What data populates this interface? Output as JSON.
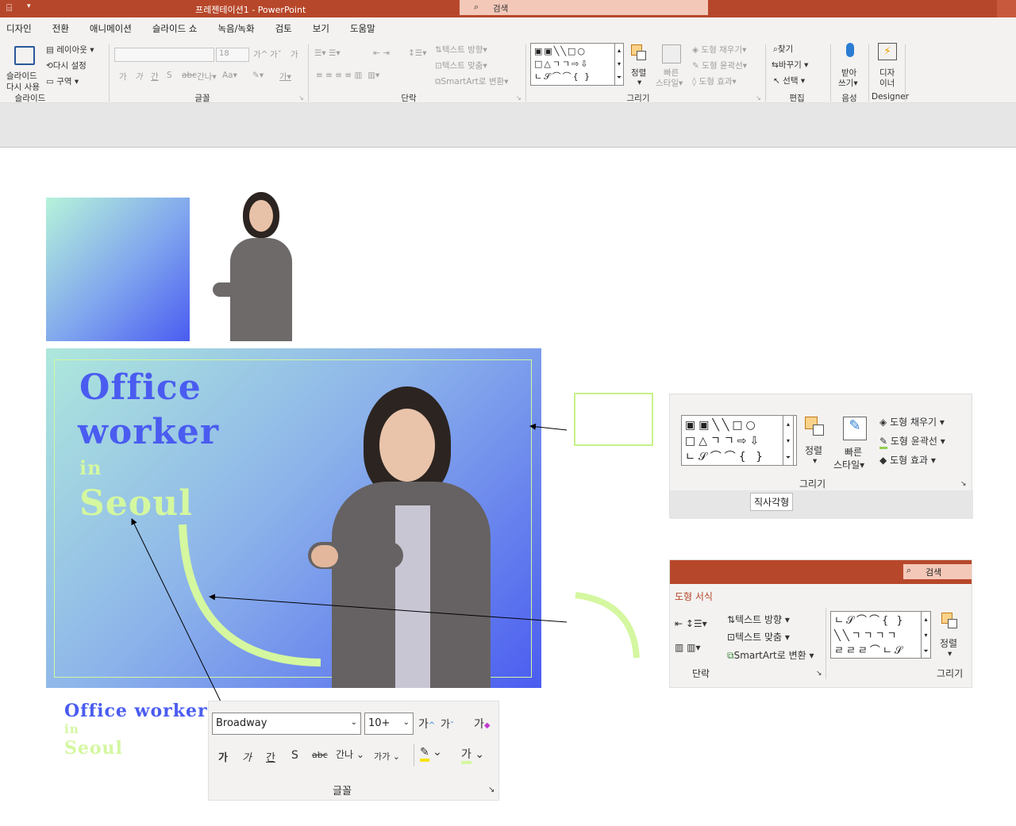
{
  "app": {
    "title": "프레젠테이션1",
    "app_name": "PowerPoint",
    "search_placeholder": "검색"
  },
  "menu": {
    "tabs": [
      "디자인",
      "전환",
      "애니메이션",
      "슬라이드 쇼",
      "녹음/녹화",
      "검토",
      "보기",
      "도움말"
    ]
  },
  "ribbon": {
    "slides": {
      "group": "슬라이드",
      "reuse": "다시 사용",
      "reuse_top": "슬라이드",
      "layout": "레이아웃",
      "reset": "다시 설정",
      "section": "구역"
    },
    "font": {
      "group": "글꼴",
      "size": "18",
      "bold": "가",
      "italic": "가",
      "underline": "간",
      "strike": "S",
      "abc": "abc",
      "spacing": "간나",
      "case": "Aa",
      "grow": "가",
      "shrink": "가",
      "clear": "가",
      "color": "가"
    },
    "paragraph": {
      "group": "단락",
      "text_dir": "텍스트 방향",
      "align_text": "텍스트 맞춤",
      "smartart": "SmartArt로 변환"
    },
    "drawing": {
      "group": "그리기",
      "arrange": "정렬",
      "quick_styles": "빠른",
      "quick_styles2": "스타일",
      "fill": "도형 채우기",
      "outline": "도형 윤곽선",
      "effects": "도형 효과"
    },
    "editing": {
      "group": "편집",
      "find": "찾기",
      "replace": "바꾸기",
      "select": "선택"
    },
    "voice": {
      "group": "음성",
      "dictate": "받아",
      "dictate2": "쓰기"
    },
    "designer": {
      "group": "Designer",
      "label": "디자",
      "label2": "이너"
    }
  },
  "slide": {
    "line1": "Office",
    "line2": "worker",
    "line3": "in",
    "line4": "Seoul"
  },
  "font_panel": {
    "font_name": "Broadway",
    "font_size": "10+",
    "group": "글꼴",
    "bold": "가",
    "italic": "가",
    "underline": "간",
    "strike": "S",
    "spacing": "간나",
    "case": "가가",
    "color": "가",
    "grow": "가",
    "shrink": "가",
    "clear": "가"
  },
  "sample": {
    "line1": "Office worker",
    "line2": "in",
    "line3": "Seoul"
  },
  "drawing_panel": {
    "arrange": "정렬",
    "quick": "빠른",
    "quick2": "스타일",
    "fill": "도형 채우기",
    "outline": "도형 윤곽선",
    "effects": "도형 효과",
    "group": "그리기",
    "tooltip": "직사각형"
  },
  "format_panel": {
    "search": "검색",
    "tab": "도형 서식",
    "text_dir": "텍스트 방향",
    "align_text": "텍스트 맞춤",
    "smartart": "SmartArt로 변환",
    "arrange": "정렬",
    "group_para": "단락",
    "group_draw": "그리기"
  },
  "colors": {
    "accent": "#b7472a",
    "blue": "#4a5cf0",
    "lime": "#d4f7a0",
    "mint": "#b4f2d8"
  }
}
